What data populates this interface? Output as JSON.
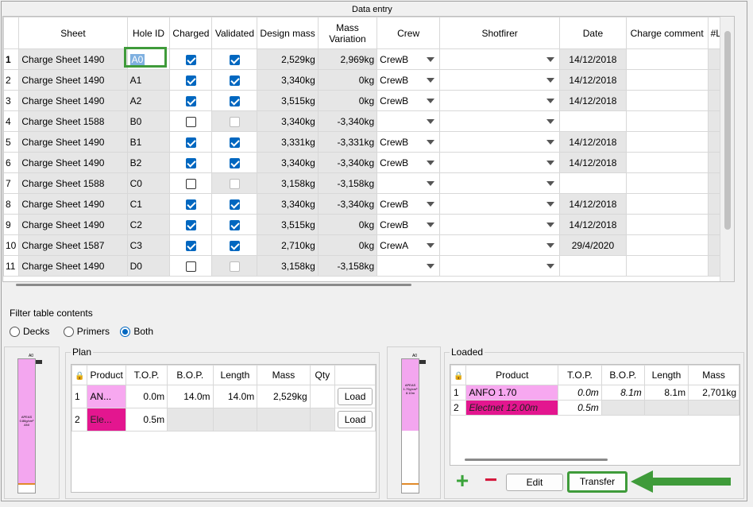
{
  "data_entry": {
    "title": "Data entry",
    "columns": [
      "Sheet",
      "Hole ID",
      "Charged",
      "Validated",
      "Design mass",
      "Mass\nVariation",
      "Crew",
      "Shotfirer",
      "Date",
      "Charge comment",
      "#L/C"
    ],
    "rows": [
      {
        "n": "1",
        "sheet": "Charge Sheet 1490",
        "hole": "A0",
        "charged": true,
        "validated": "on",
        "design": "2,529kg",
        "variation": "2,969kg",
        "crew": "CrewB",
        "date": "14/12/2018"
      },
      {
        "n": "2",
        "sheet": "Charge Sheet 1490",
        "hole": "A1",
        "charged": true,
        "validated": "on",
        "design": "3,340kg",
        "variation": "0kg",
        "crew": "CrewB",
        "date": "14/12/2018"
      },
      {
        "n": "3",
        "sheet": "Charge Sheet 1490",
        "hole": "A2",
        "charged": true,
        "validated": "on",
        "design": "3,515kg",
        "variation": "0kg",
        "crew": "CrewB",
        "date": "14/12/2018"
      },
      {
        "n": "4",
        "sheet": "Charge Sheet 1588",
        "hole": "B0",
        "charged": false,
        "validated": "dis",
        "design": "3,340kg",
        "variation": "-3,340kg",
        "crew": "",
        "date": ""
      },
      {
        "n": "5",
        "sheet": "Charge Sheet 1490",
        "hole": "B1",
        "charged": true,
        "validated": "on",
        "design": "3,331kg",
        "variation": "-3,331kg",
        "crew": "CrewB",
        "date": "14/12/2018"
      },
      {
        "n": "6",
        "sheet": "Charge Sheet 1490",
        "hole": "B2",
        "charged": true,
        "validated": "on",
        "design": "3,340kg",
        "variation": "-3,340kg",
        "crew": "CrewB",
        "date": "14/12/2018"
      },
      {
        "n": "7",
        "sheet": "Charge Sheet 1588",
        "hole": "C0",
        "charged": false,
        "validated": "dis",
        "design": "3,158kg",
        "variation": "-3,158kg",
        "crew": "",
        "date": ""
      },
      {
        "n": "8",
        "sheet": "Charge Sheet 1490",
        "hole": "C1",
        "charged": true,
        "validated": "on",
        "design": "3,340kg",
        "variation": "-3,340kg",
        "crew": "CrewB",
        "date": "14/12/2018"
      },
      {
        "n": "9",
        "sheet": "Charge Sheet 1490",
        "hole": "C2",
        "charged": true,
        "validated": "on",
        "design": "3,515kg",
        "variation": "0kg",
        "crew": "CrewB",
        "date": "14/12/2018"
      },
      {
        "n": "10",
        "sheet": "Charge Sheet 1587",
        "hole": "C3",
        "charged": true,
        "validated": "on",
        "design": "2,710kg",
        "variation": "0kg",
        "crew": "CrewA",
        "date": "29/4/2020"
      },
      {
        "n": "11",
        "sheet": "Charge Sheet 1490",
        "hole": "D0",
        "charged": false,
        "validated": "dis",
        "design": "3,158kg",
        "variation": "-3,158kg",
        "crew": "",
        "date": ""
      }
    ]
  },
  "filter": {
    "title": "Filter table contents",
    "options": [
      "Decks",
      "Primers",
      "Both"
    ],
    "selected": "Both"
  },
  "plan": {
    "title": "Plan",
    "columns": [
      "Product",
      "T.O.P.",
      "B.O.P.",
      "Length",
      "Mass",
      "Qty"
    ],
    "rows": [
      {
        "n": "1",
        "product": "AN...",
        "top": "0.0m",
        "bop": "14.0m",
        "length": "14.0m",
        "mass": "2,529kg",
        "qty": "",
        "button": "Load"
      },
      {
        "n": "2",
        "product": "Ele...",
        "top": "0.5m",
        "bop": "",
        "length": "",
        "mass": "",
        "qty": "",
        "button": "Load"
      }
    ],
    "hole_diagram": {
      "hole": "A0",
      "product_lines": [
        "APEAS",
        "0.86g/cm³",
        "ANI"
      ]
    }
  },
  "loaded": {
    "title": "Loaded",
    "columns": [
      "Product",
      "T.O.P.",
      "B.O.P.",
      "Length",
      "Mass"
    ],
    "rows": [
      {
        "n": "1",
        "product": "ANFO 1.70",
        "top": "0.0m",
        "bop": "8.1m",
        "length": "8.1m",
        "mass": "2,701kg"
      },
      {
        "n": "2",
        "product": "Electnet 12.00m",
        "top": "0.5m",
        "bop": "",
        "length": "",
        "mass": ""
      }
    ],
    "hole_diagram": {
      "hole": "A0",
      "product_lines": [
        "APEAS",
        "1.70g/cm³",
        "8.10m"
      ]
    }
  },
  "actions": {
    "add": "+",
    "remove": "−",
    "edit": "Edit",
    "transfer": "Transfer"
  },
  "colors": {
    "highlight": "#3f9b3a",
    "pink_product": "#f7a8f0",
    "magenta_product": "#e3168f",
    "accent": "#0067c0"
  }
}
